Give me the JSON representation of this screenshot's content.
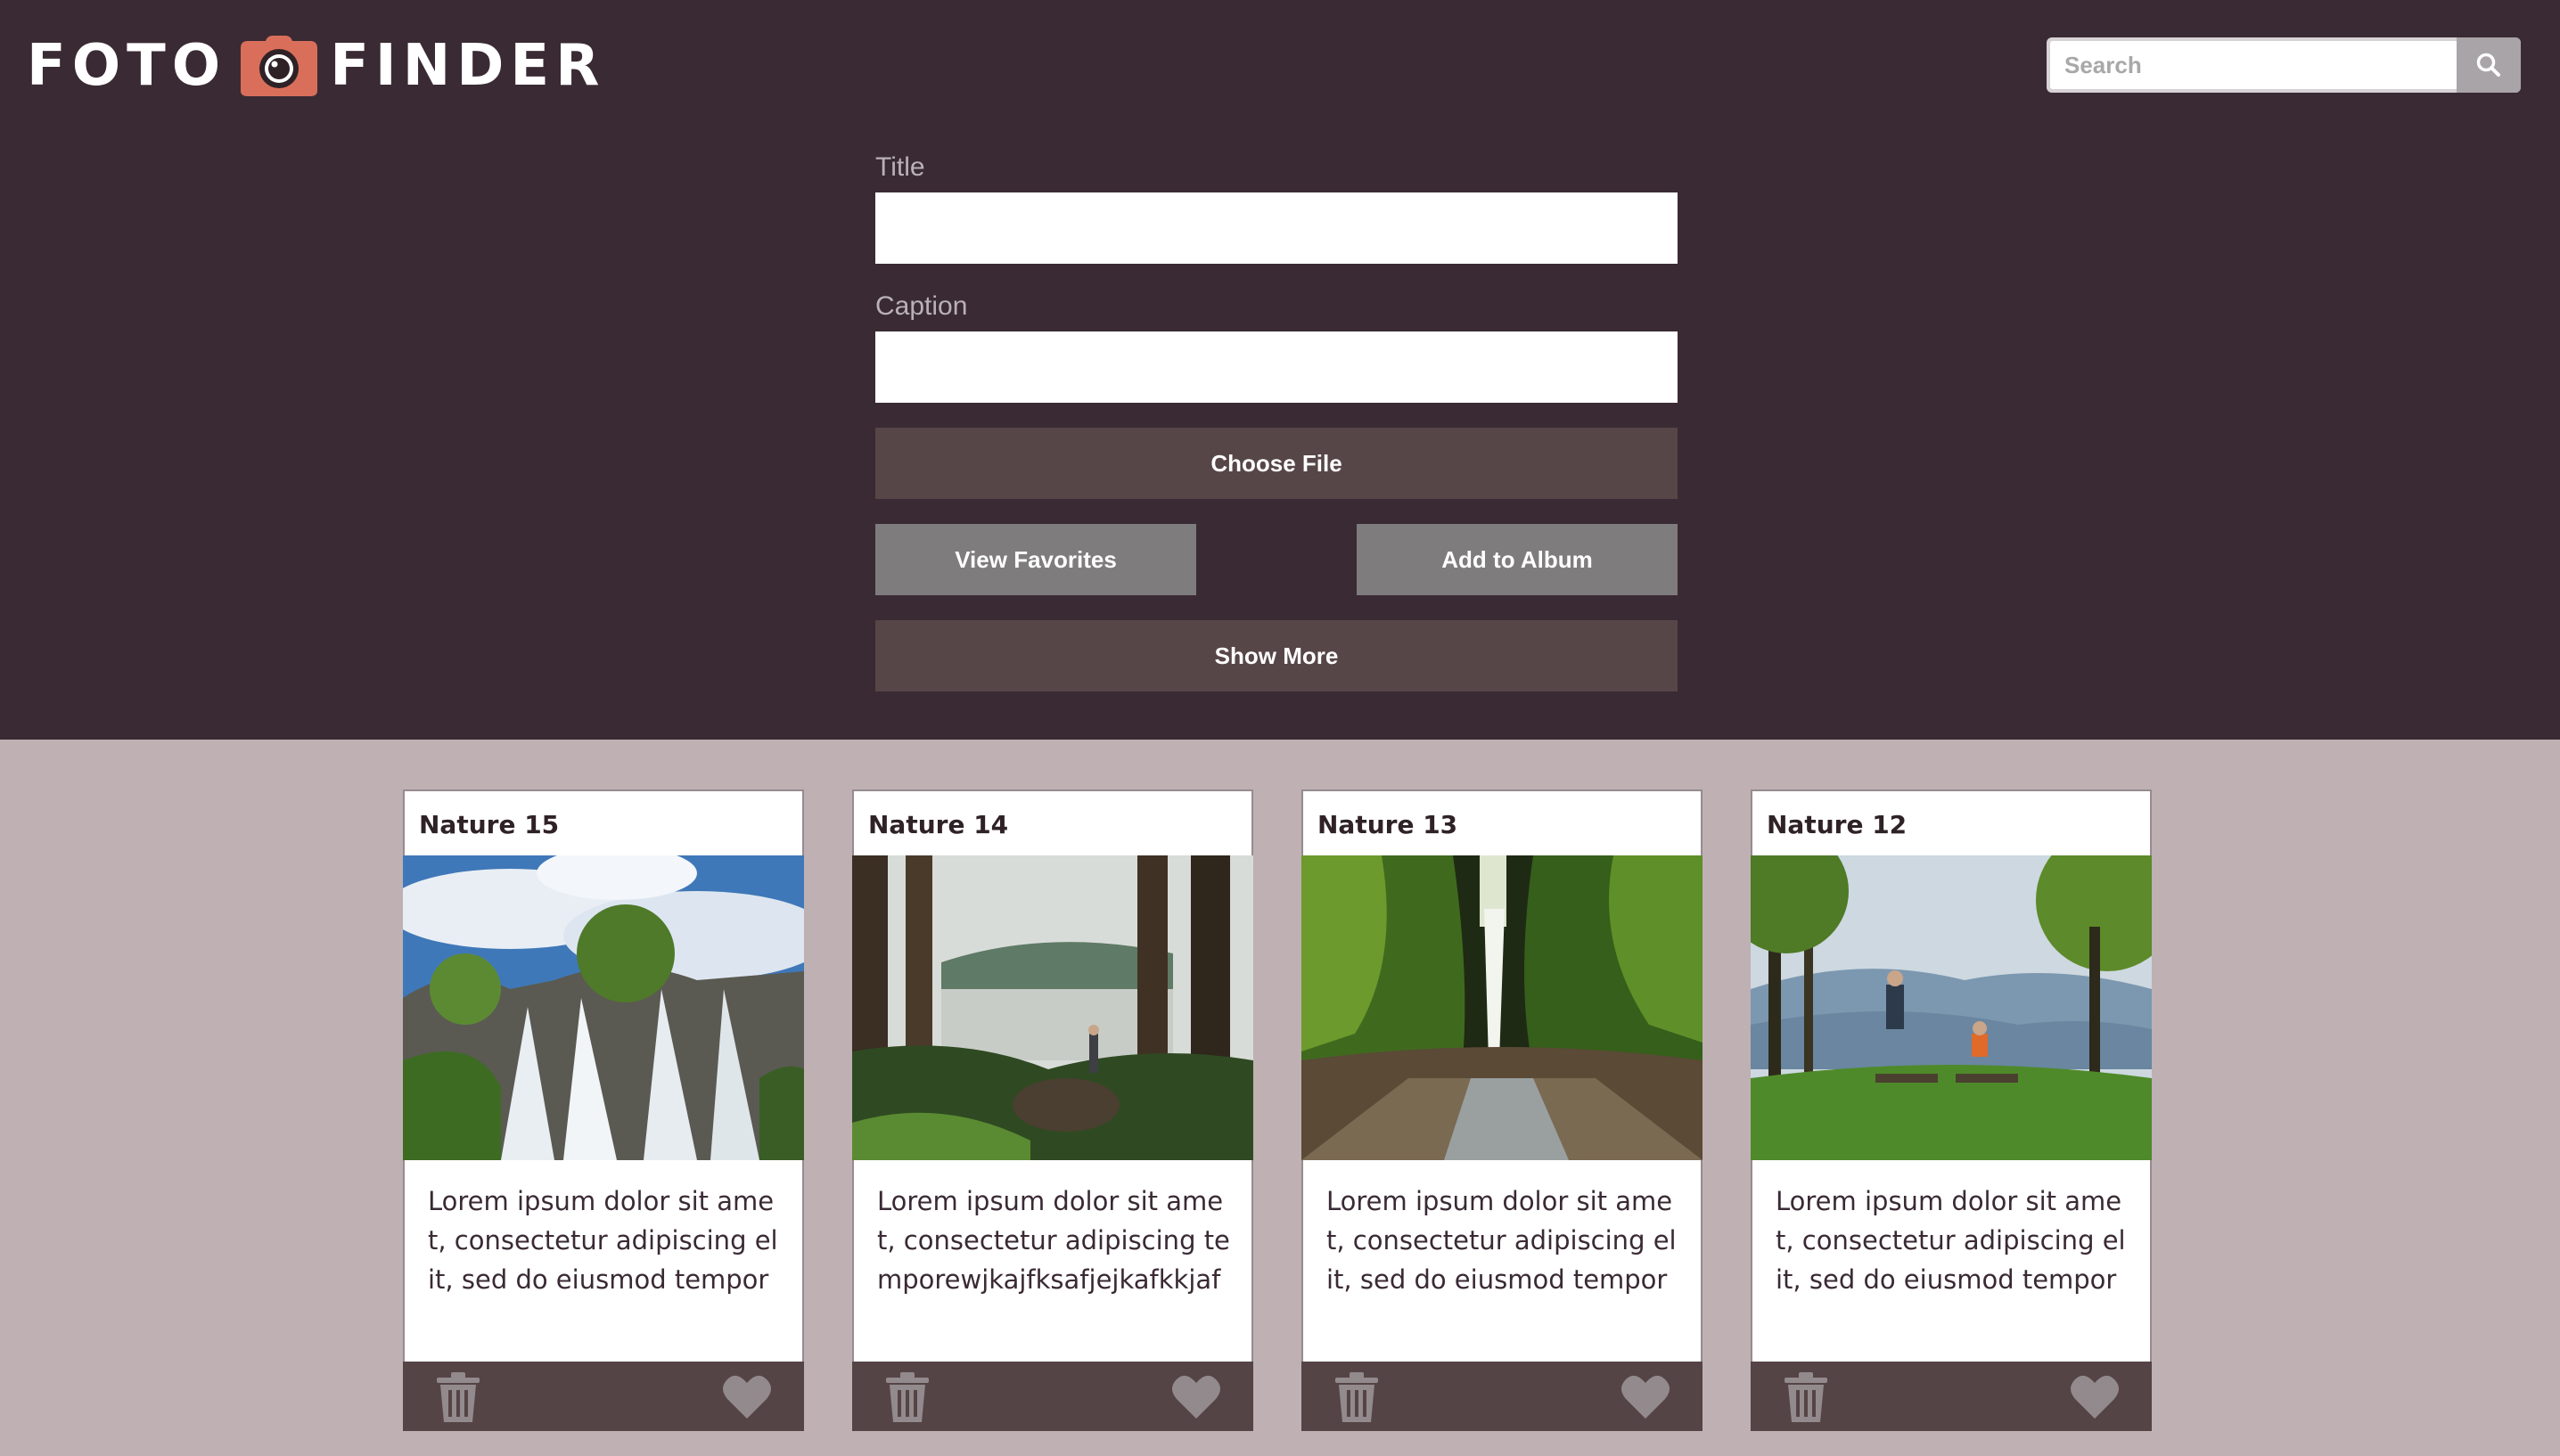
{
  "brand": {
    "word_left": "FOTO",
    "word_right": "FINDER"
  },
  "search": {
    "placeholder": "Search"
  },
  "form": {
    "title_label": "Title",
    "caption_label": "Caption",
    "choose_file_label": "Choose File",
    "view_favorites_label": "View Favorites",
    "add_to_album_label": "Add to Album",
    "show_more_label": "Show More"
  },
  "cards": [
    {
      "title": "Nature 15",
      "caption": "Lorem ipsum dolor sit amet, consectetur adipiscing elit, sed do eiusmod tempor"
    },
    {
      "title": "Nature 14",
      "caption": "Lorem ipsum dolor sit amet, consectetur adipiscing temporewjkajfksafjejkafkkjaf"
    },
    {
      "title": "Nature 13",
      "caption": "Lorem ipsum dolor sit amet, consectetur adipiscing elit, sed do eiusmod tempor"
    },
    {
      "title": "Nature 12",
      "caption": "Lorem ipsum dolor sit amet, consectetur adipiscing elit, sed do eiusmod tempor"
    }
  ],
  "colors": {
    "header_bg": "#3a2a34",
    "page_bg": "#bfb0b3",
    "camera_accent": "#d96f5a",
    "button_dark": "#574648",
    "button_gray": "#7e7c7d"
  },
  "icons": [
    "camera-icon",
    "search-icon",
    "trash-icon",
    "heart-icon"
  ]
}
